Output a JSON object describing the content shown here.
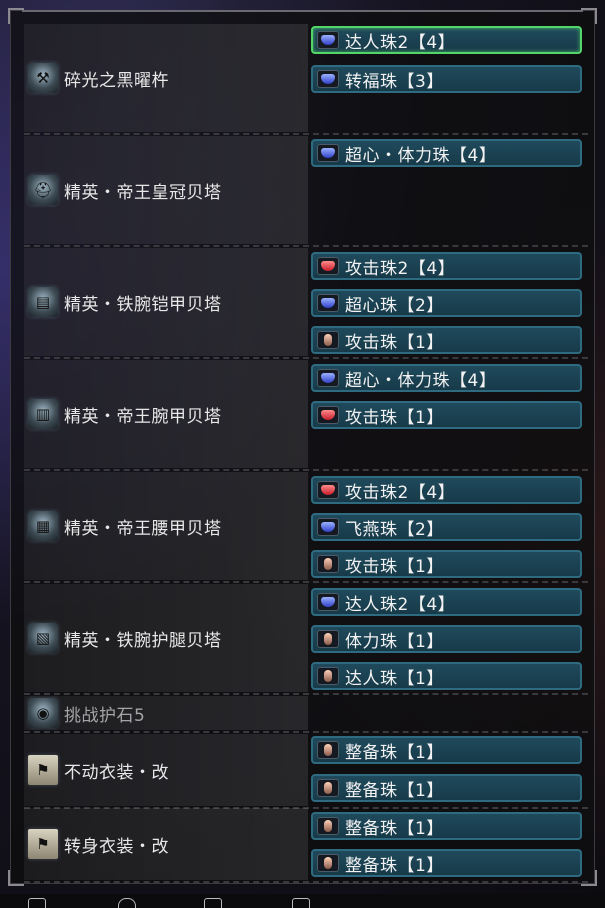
{
  "equipment": [
    {
      "name": "碎光之黑曜杵",
      "icon": "weapon-icon",
      "decorations": [
        {
          "label": "达人珠2【4】",
          "gem": "blue",
          "selected": true
        },
        {
          "label": "转福珠【3】",
          "gem": "blue"
        }
      ]
    },
    {
      "name": "精英・帝王皇冠贝塔",
      "icon": "helm-icon",
      "decorations": [
        {
          "label": "超心・体力珠【4】",
          "gem": "blue"
        }
      ]
    },
    {
      "name": "精英・铁腕铠甲贝塔",
      "icon": "chest-icon",
      "decorations": [
        {
          "label": "攻击珠2【4】",
          "gem": "red"
        },
        {
          "label": "超心珠【2】",
          "gem": "blue"
        },
        {
          "label": "攻击珠【1】",
          "gem": "bronze"
        }
      ]
    },
    {
      "name": "精英・帝王腕甲贝塔",
      "icon": "arms-icon",
      "decorations": [
        {
          "label": "超心・体力珠【4】",
          "gem": "blue"
        },
        {
          "label": "攻击珠【1】",
          "gem": "red"
        }
      ]
    },
    {
      "name": "精英・帝王腰甲贝塔",
      "icon": "waist-icon",
      "decorations": [
        {
          "label": "攻击珠2【4】",
          "gem": "red"
        },
        {
          "label": "飞燕珠【2】",
          "gem": "blue"
        },
        {
          "label": "攻击珠【1】",
          "gem": "bronze"
        }
      ]
    },
    {
      "name": "精英・铁腕护腿贝塔",
      "icon": "legs-icon",
      "decorations": [
        {
          "label": "达人珠2【4】",
          "gem": "blue"
        },
        {
          "label": "体力珠【1】",
          "gem": "bronze"
        },
        {
          "label": "达人珠【1】",
          "gem": "bronze"
        }
      ]
    },
    {
      "name": "挑战护石5",
      "icon": "charm-icon",
      "dim": true,
      "decorations": []
    },
    {
      "name": "不动衣装・改",
      "icon": "mantle-icon",
      "decorations": [
        {
          "label": "整备珠【1】",
          "gem": "bronze"
        },
        {
          "label": "整备珠【1】",
          "gem": "bronze"
        }
      ]
    },
    {
      "name": "转身衣装・改",
      "icon": "mantle-icon",
      "decorations": [
        {
          "label": "整备珠【1】",
          "gem": "bronze"
        },
        {
          "label": "整备珠【1】",
          "gem": "bronze"
        }
      ]
    }
  ]
}
